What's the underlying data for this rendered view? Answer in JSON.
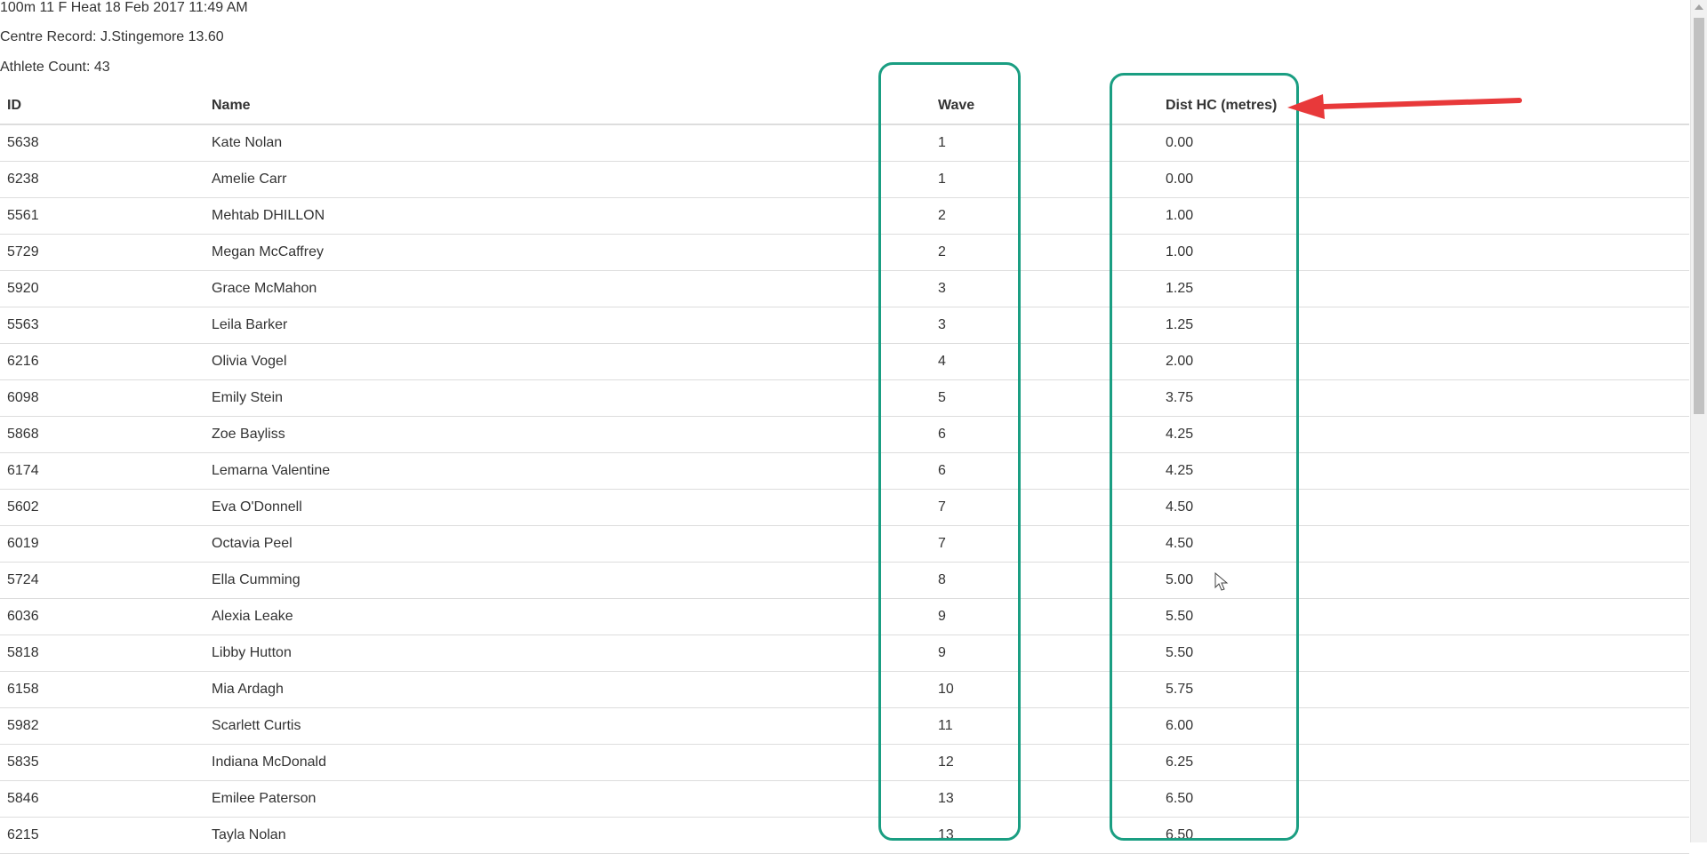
{
  "meta": {
    "event_title": "100m 11 F Heat 18 Feb 2017 11:49 AM",
    "centre_record": "Centre Record: J.Stingemore 13.60",
    "athlete_count": "Athlete Count: 43"
  },
  "table": {
    "headers": {
      "id": "ID",
      "name": "Name",
      "wave": "Wave",
      "dist": "Dist HC (metres)"
    },
    "rows": [
      {
        "id": "5638",
        "name": "Kate Nolan",
        "wave": "1",
        "dist": "0.00"
      },
      {
        "id": "6238",
        "name": "Amelie Carr",
        "wave": "1",
        "dist": "0.00"
      },
      {
        "id": "5561",
        "name": "Mehtab DHILLON",
        "wave": "2",
        "dist": "1.00"
      },
      {
        "id": "5729",
        "name": "Megan McCaffrey",
        "wave": "2",
        "dist": "1.00"
      },
      {
        "id": "5920",
        "name": "Grace McMahon",
        "wave": "3",
        "dist": "1.25"
      },
      {
        "id": "5563",
        "name": "Leila Barker",
        "wave": "3",
        "dist": "1.25"
      },
      {
        "id": "6216",
        "name": "Olivia Vogel",
        "wave": "4",
        "dist": "2.00"
      },
      {
        "id": "6098",
        "name": "Emily Stein",
        "wave": "5",
        "dist": "3.75"
      },
      {
        "id": "5868",
        "name": "Zoe Bayliss",
        "wave": "6",
        "dist": "4.25"
      },
      {
        "id": "6174",
        "name": "Lemarna Valentine",
        "wave": "6",
        "dist": "4.25"
      },
      {
        "id": "5602",
        "name": "Eva O'Donnell",
        "wave": "7",
        "dist": "4.50"
      },
      {
        "id": "6019",
        "name": "Octavia Peel",
        "wave": "7",
        "dist": "4.50"
      },
      {
        "id": "5724",
        "name": "Ella Cumming",
        "wave": "8",
        "dist": "5.00"
      },
      {
        "id": "6036",
        "name": "Alexia Leake",
        "wave": "9",
        "dist": "5.50"
      },
      {
        "id": "5818",
        "name": "Libby Hutton",
        "wave": "9",
        "dist": "5.50"
      },
      {
        "id": "6158",
        "name": "Mia Ardagh",
        "wave": "10",
        "dist": "5.75"
      },
      {
        "id": "5982",
        "name": "Scarlett Curtis",
        "wave": "11",
        "dist": "6.00"
      },
      {
        "id": "5835",
        "name": "Indiana McDonald",
        "wave": "12",
        "dist": "6.25"
      },
      {
        "id": "5846",
        "name": "Emilee Paterson",
        "wave": "13",
        "dist": "6.50"
      },
      {
        "id": "6215",
        "name": "Tayla Nolan",
        "wave": "13",
        "dist": "6.50"
      }
    ]
  },
  "annotations": {
    "highlight_color": "#1a9e82",
    "arrow_color": "#e8393a"
  }
}
